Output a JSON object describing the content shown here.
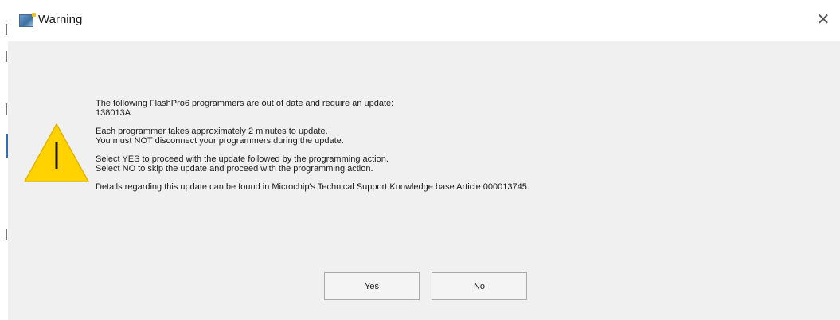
{
  "window": {
    "title": "Warning",
    "close_glyph": "✕",
    "icon": "app-window-icon"
  },
  "dialog": {
    "icon": "warning-triangle-icon",
    "icon_color": "#ffd200",
    "paragraphs": [
      {
        "lines": [
          "The following FlashPro6 programmers are out of date and require an update:",
          "138013A"
        ]
      },
      {
        "lines": [
          "Each programmer takes approximately 2 minutes to update.",
          "You must NOT disconnect your programmers during the update."
        ]
      },
      {
        "lines": [
          "Select YES to proceed with the update followed by the programming action.",
          "Select NO to skip the update and proceed with the programming action."
        ]
      },
      {
        "lines": [
          "Details regarding this update can be found in Microchip's Technical Support Knowledge base Article 000013745."
        ]
      }
    ]
  },
  "buttons": {
    "yes_label": "Yes",
    "no_label": "No"
  }
}
